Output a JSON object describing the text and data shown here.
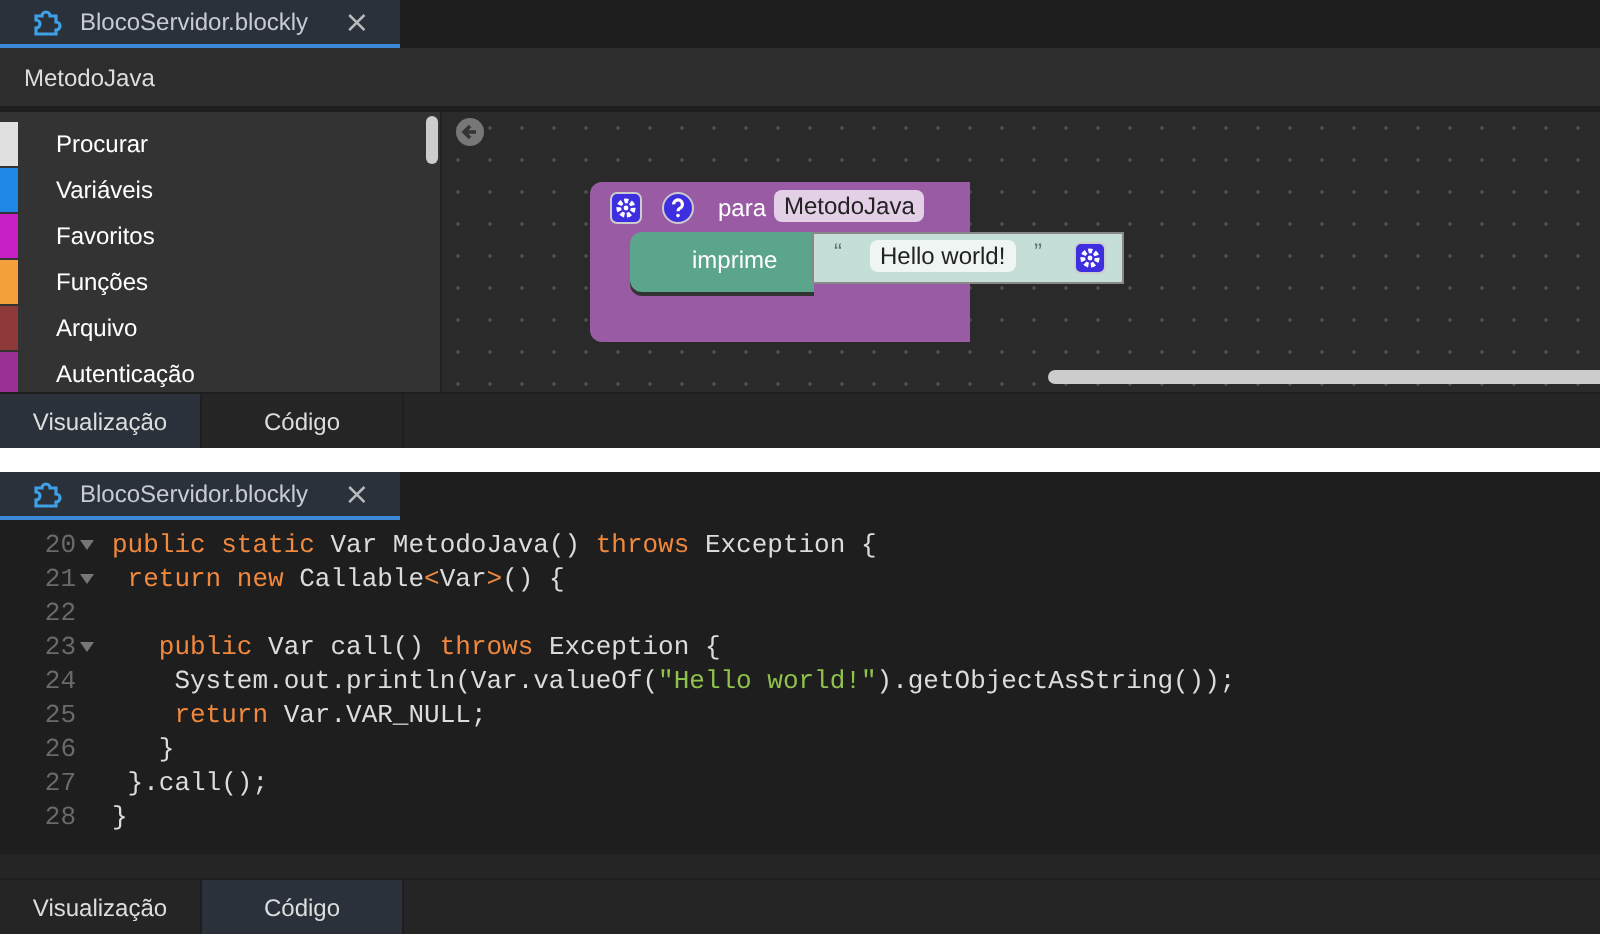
{
  "top_panel": {
    "file_tab": {
      "title": "BlocoServidor.blockly",
      "close": "×"
    },
    "breadcrumb": "MetodoJava",
    "categories": [
      {
        "label": "Procurar",
        "color": "#e0e0e0"
      },
      {
        "label": "Variáveis",
        "color": "#1e88e5"
      },
      {
        "label": "Favoritos",
        "color": "#c51fc5"
      },
      {
        "label": "Funções",
        "color": "#f4a03c"
      },
      {
        "label": "Arquivo",
        "color": "#8e3a3a"
      },
      {
        "label": "Autenticação",
        "color": "#9b2f95"
      }
    ],
    "block": {
      "keyword": "para",
      "name": "MetodoJava",
      "statement": "imprime",
      "open_quote": "“",
      "text": "Hello world!",
      "close_quote": "”"
    },
    "view_tabs": [
      {
        "label": "Visualização",
        "selected": true
      },
      {
        "label": "Código",
        "selected": false
      }
    ]
  },
  "bottom_panel": {
    "file_tab": {
      "title": "BlocoServidor.blockly",
      "close": "×"
    },
    "code_lines": [
      {
        "number": "20",
        "foldable": true,
        "tokens": [
          {
            "kind": "keyword",
            "text": "public static "
          },
          {
            "kind": "plain",
            "text": "Var MetodoJava() "
          },
          {
            "kind": "keyword",
            "text": "throws "
          },
          {
            "kind": "plain",
            "text": "Exception {"
          }
        ]
      },
      {
        "number": "21",
        "foldable": true,
        "tokens": [
          {
            "kind": "keyword",
            "text": " return new "
          },
          {
            "kind": "plain",
            "text": "Callable"
          },
          {
            "kind": "keyword",
            "text": "<"
          },
          {
            "kind": "plain",
            "text": "Var"
          },
          {
            "kind": "keyword",
            "text": ">"
          },
          {
            "kind": "plain",
            "text": "() {"
          }
        ]
      },
      {
        "number": "22",
        "foldable": false
      },
      {
        "number": "23",
        "foldable": true,
        "tokens": [
          {
            "kind": "keyword",
            "text": "   public "
          },
          {
            "kind": "plain",
            "text": "Var call() "
          },
          {
            "kind": "keyword",
            "text": "throws "
          },
          {
            "kind": "plain",
            "text": "Exception {"
          }
        ]
      },
      {
        "number": "24",
        "foldable": false,
        "tokens": [
          {
            "kind": "plain",
            "text": "    System.out.println(Var.valueOf("
          },
          {
            "kind": "string",
            "text": "\"Hello world!\""
          },
          {
            "kind": "plain",
            "text": ").getObjectAsString());"
          }
        ]
      },
      {
        "number": "25",
        "foldable": false,
        "tokens": [
          {
            "kind": "keyword",
            "text": "    return "
          },
          {
            "kind": "plain",
            "text": "Var.VAR_NULL;"
          }
        ]
      },
      {
        "number": "26",
        "foldable": false,
        "tokens": [
          {
            "kind": "plain",
            "text": "   }"
          }
        ]
      },
      {
        "number": "27",
        "foldable": false,
        "tokens": [
          {
            "kind": "plain",
            "text": " }.call();"
          }
        ]
      },
      {
        "number": "28",
        "foldable": false,
        "tokens": [
          {
            "kind": "plain",
            "text": "}"
          }
        ]
      }
    ],
    "view_tabs": [
      {
        "label": "Visualização",
        "selected": false
      },
      {
        "label": "Código",
        "selected": true
      }
    ]
  }
}
